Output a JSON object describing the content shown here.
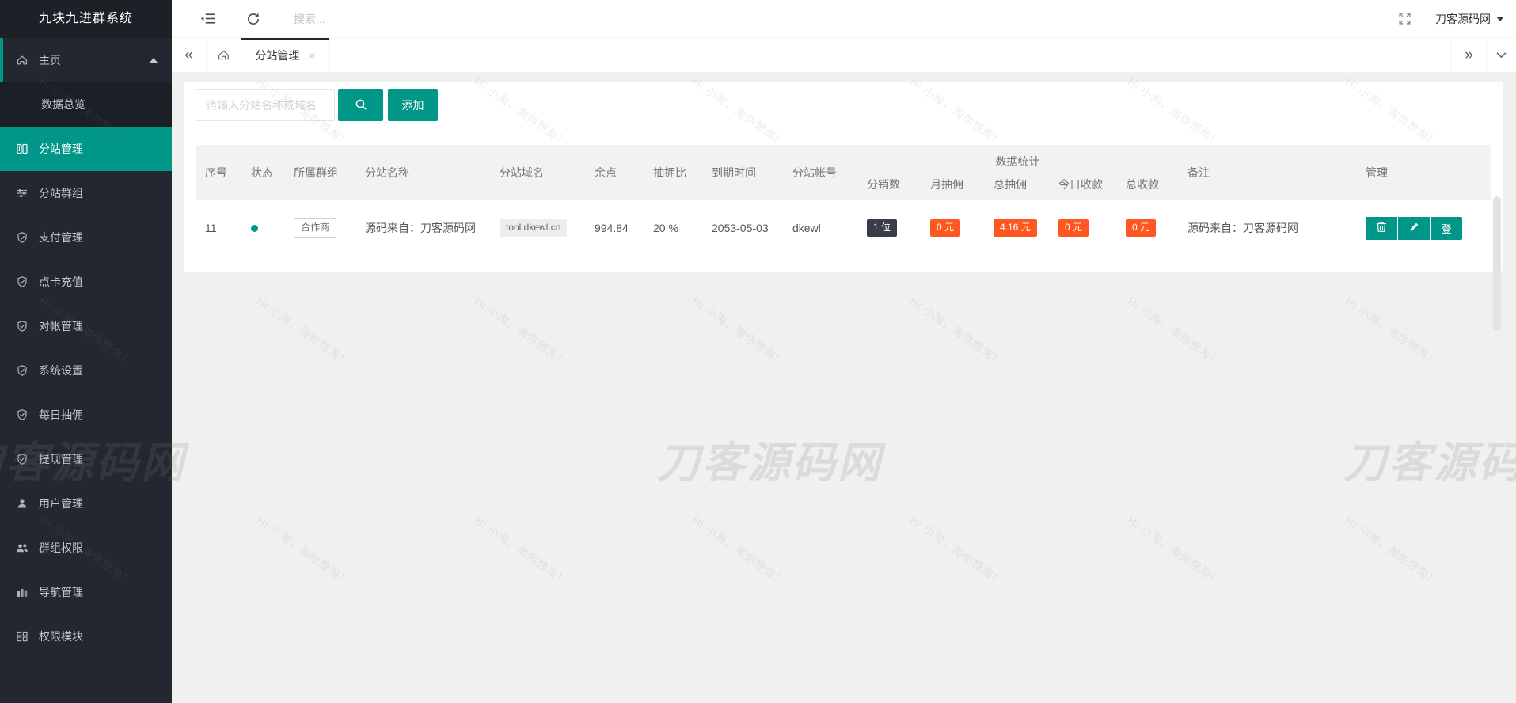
{
  "app": {
    "title": "九块九进群系统"
  },
  "sidebar": {
    "items": [
      {
        "label": "主页"
      },
      {
        "label": "数据总览"
      },
      {
        "label": "分站管理"
      },
      {
        "label": "分站群组"
      },
      {
        "label": "支付管理"
      },
      {
        "label": "点卡充值"
      },
      {
        "label": "对帐管理"
      },
      {
        "label": "系统设置"
      },
      {
        "label": "每日抽佣"
      },
      {
        "label": "提现管理"
      },
      {
        "label": "用户管理"
      },
      {
        "label": "群组权限"
      },
      {
        "label": "导航管理"
      },
      {
        "label": "权限模块"
      }
    ]
  },
  "topbar": {
    "search_placeholder": "搜索...",
    "username": "刀客源码网"
  },
  "tabbar": {
    "active_tab": "分站管理",
    "close_label": "×",
    "prev_label": "«",
    "next_label": "»"
  },
  "toolbar": {
    "search_placeholder": "请输入分站名称或域名",
    "add_label": "添加"
  },
  "table": {
    "headers": {
      "seq": "序号",
      "status": "状态",
      "group": "所属群组",
      "site_name": "分站名称",
      "domain": "分站域名",
      "balance": "余点",
      "rate": "抽拥比",
      "expire": "到期时间",
      "account": "分站帐号",
      "stats": "数据统计",
      "resellers": "分销数",
      "month_commission": "月抽佣",
      "total_commission": "总抽佣",
      "today_income": "今日收款",
      "total_income": "总收款",
      "remark": "备注",
      "manage": "管理"
    },
    "row": {
      "seq": "11",
      "group": "合作商",
      "site_name": "源码来自：刀客源码网",
      "domain": "tool.dkewl.cn",
      "balance": "994.84",
      "rate": "20 %",
      "expire": "2053-05-03",
      "account": "dkewl",
      "resellers": "1 位",
      "month_commission": "0 元",
      "total_commission": "4.16 元",
      "today_income": "0 元",
      "total_income": "0 元",
      "remark": "源码来自：刀客源码网",
      "login_label": "登"
    }
  },
  "watermark": {
    "small_text": "Hi 小淘，淘你想淘！",
    "large_text": "刀客源码网"
  },
  "colors": {
    "accent": "#009688",
    "danger": "#FF5722",
    "dark_badge": "#393D49",
    "sidebar_bg": "#23272f"
  }
}
